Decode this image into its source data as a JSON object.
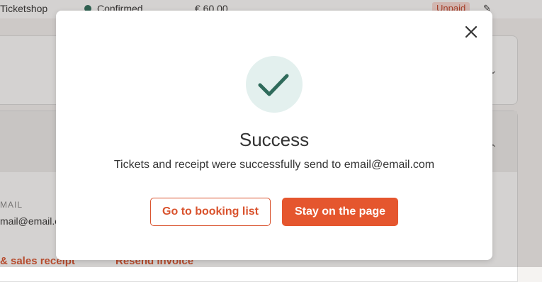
{
  "background": {
    "row": {
      "source": "Ticketshop",
      "status": "Confirmed",
      "amount": "€ 60.00",
      "payment_badge": "Unpaid"
    },
    "email_label": "MAIL",
    "email_value": "mail@email.c",
    "actions": {
      "receipt": "& sales receipt",
      "invoice": "Resend invoice"
    }
  },
  "modal": {
    "title": "Success",
    "message": "Tickets and receipt were successfully send to email@email.com",
    "buttons": {
      "secondary": "Go to booking list",
      "primary": "Stay on the page"
    },
    "icons": {
      "close": "close-icon",
      "status": "checkmark-icon"
    }
  },
  "colors": {
    "accent": "#e5562e",
    "success_bg": "#e3f0ee",
    "success_check": "#2f6b5b",
    "status_dot": "#2c6e5a"
  }
}
